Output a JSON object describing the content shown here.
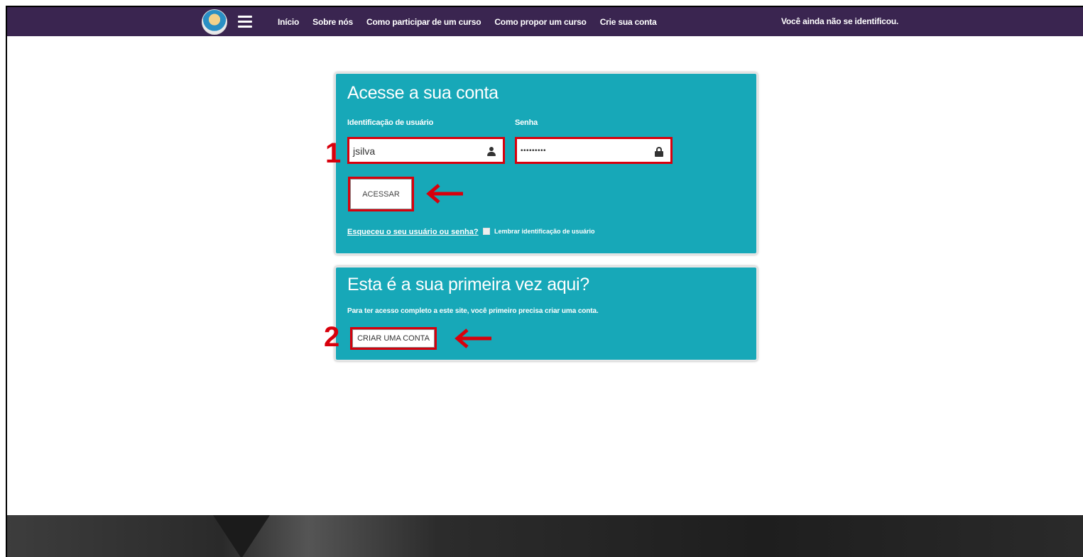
{
  "navbar": {
    "links": [
      "Início",
      "Sobre nós",
      "Como participar de um curso",
      "Como propor um curso",
      "Crie sua conta"
    ],
    "status": "Você ainda não se identificou."
  },
  "login": {
    "title": "Acesse a sua conta",
    "username_label": "Identificação de usuário",
    "username_value": "jsilva",
    "password_label": "Senha",
    "password_value": "•••••••••",
    "submit_label": "ACESSAR",
    "forgot_link": "Esqueceu o seu usuário ou senha?",
    "remember_label": "Lembrar identificação de usuário"
  },
  "signup": {
    "title": "Esta é a sua primeira vez aqui?",
    "description": "Para ter acesso completo a este site, você primeiro precisa criar uma conta.",
    "button_label": "CRIAR UMA CONTA"
  },
  "annotations": {
    "marker_1": "1",
    "marker_2": "2"
  },
  "colors": {
    "navbar": "#3a2550",
    "card": "#17a8b8",
    "highlight": "#d8000c"
  }
}
